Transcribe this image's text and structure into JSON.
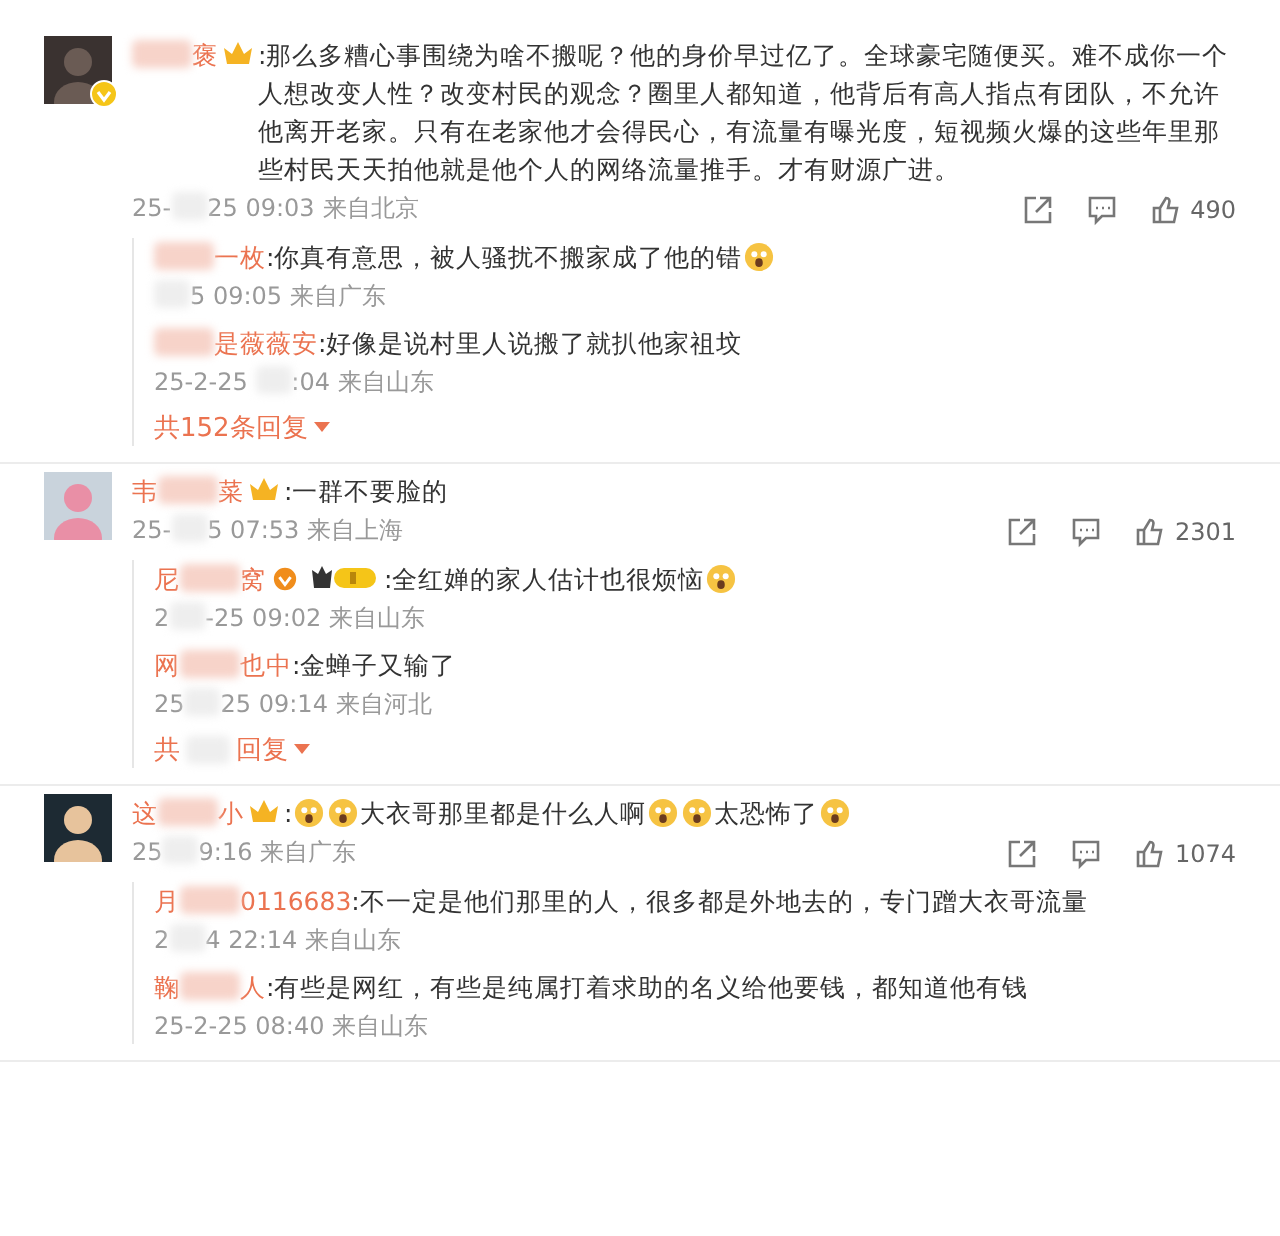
{
  "comments": [
    {
      "avatar": {
        "kind": "photo"
      },
      "verified": true,
      "name": [
        {
          "kind": "blur"
        },
        {
          "kind": "text",
          "text": "褒"
        }
      ],
      "crown": true,
      "content": [
        {
          "kind": "text",
          "text": ":那么多糟心事围绕为啥不搬呢？他的身价早过亿了。全球豪宅随便买。难不成你一个人想改变人性？改变村民的观念？圈里人都知道，他背后有高人指点有团队，不允许他离开老家。只有在老家他才会得民心，有流量有曝光度，短视频火爆的这些年里那些村民天天拍他就是他个人的网络流量推手。才有财源广进。"
        }
      ],
      "time": [
        {
          "kind": "text",
          "text": "25-"
        },
        {
          "kind": "blur"
        },
        {
          "kind": "text",
          "text": "25 09:03"
        }
      ],
      "location": "来自北京",
      "likes": "490",
      "replies": [
        {
          "name": [
            {
              "kind": "blur"
            },
            {
              "kind": "text",
              "text": "一枚"
            }
          ],
          "content": [
            {
              "kind": "text",
              "text": ":你真有意思，被人骚扰不搬家成了他的错"
            },
            {
              "kind": "emoji"
            }
          ],
          "time": [
            {
              "kind": "blur"
            },
            {
              "kind": "text",
              "text": "5 09:05"
            }
          ],
          "location": "来自广东"
        },
        {
          "name": [
            {
              "kind": "blur"
            },
            {
              "kind": "text",
              "text": "是薇薇安"
            }
          ],
          "content": [
            {
              "kind": "text",
              "text": ":好像是说村里人说搬了就扒他家祖坟"
            }
          ],
          "time": [
            {
              "kind": "text",
              "text": "25-2-25 "
            },
            {
              "kind": "blur"
            },
            {
              "kind": "text",
              "text": ":04"
            }
          ],
          "location": "来自山东"
        }
      ],
      "more": [
        {
          "kind": "text",
          "text": "共152条回复"
        }
      ]
    },
    {
      "avatar": {
        "kind": "girl"
      },
      "verified": false,
      "name": [
        {
          "kind": "text",
          "text": "韦"
        },
        {
          "kind": "blur"
        },
        {
          "kind": "text",
          "text": "菜"
        }
      ],
      "crown": true,
      "content": [
        {
          "kind": "text",
          "text": ":一群不要脸的"
        }
      ],
      "time": [
        {
          "kind": "text",
          "text": "25-"
        },
        {
          "kind": "blur"
        },
        {
          "kind": "text",
          "text": "5 07:53"
        }
      ],
      "location": "来自上海",
      "likes": "2301",
      "replies": [
        {
          "name": [
            {
              "kind": "text",
              "text": "尼"
            },
            {
              "kind": "blur"
            },
            {
              "kind": "text",
              "text": "窝"
            }
          ],
          "verified": true,
          "level": true,
          "content": [
            {
              "kind": "text",
              "text": ":全红婵的家人估计也很烦恼"
            },
            {
              "kind": "emoji"
            }
          ],
          "time": [
            {
              "kind": "text",
              "text": "2"
            },
            {
              "kind": "blur"
            },
            {
              "kind": "text",
              "text": "-25 09:02"
            }
          ],
          "location": "来自山东"
        },
        {
          "name": [
            {
              "kind": "text",
              "text": "网"
            },
            {
              "kind": "blur"
            },
            {
              "kind": "text",
              "text": "也中"
            }
          ],
          "content": [
            {
              "kind": "text",
              "text": ":金蝉子又输了"
            }
          ],
          "time": [
            {
              "kind": "text",
              "text": "25"
            },
            {
              "kind": "blur"
            },
            {
              "kind": "text",
              "text": "25 09:14"
            }
          ],
          "location": "来自河北"
        }
      ],
      "more": [
        {
          "kind": "text",
          "text": "共"
        },
        {
          "kind": "blur"
        },
        {
          "kind": "text",
          "text": "回复"
        }
      ]
    },
    {
      "avatar": {
        "kind": "cartoon"
      },
      "verified": false,
      "name": [
        {
          "kind": "text",
          "text": "这"
        },
        {
          "kind": "blur"
        },
        {
          "kind": "text",
          "text": "小"
        }
      ],
      "crown": true,
      "content": [
        {
          "kind": "text",
          "text": ":"
        },
        {
          "kind": "emoji"
        },
        {
          "kind": "emoji"
        },
        {
          "kind": "text",
          "text": "大衣哥那里都是什么人啊"
        },
        {
          "kind": "emoji"
        },
        {
          "kind": "emoji"
        },
        {
          "kind": "text",
          "text": "太恐怖了"
        },
        {
          "kind": "emoji"
        }
      ],
      "time": [
        {
          "kind": "text",
          "text": "25"
        },
        {
          "kind": "blur"
        },
        {
          "kind": "text",
          "text": "9:16"
        }
      ],
      "location": "来自广东",
      "likes": "1074",
      "replies": [
        {
          "name": [
            {
              "kind": "text",
              "text": "月"
            },
            {
              "kind": "blur"
            },
            {
              "kind": "text",
              "text": "0116683"
            }
          ],
          "content": [
            {
              "kind": "text",
              "text": ":不一定是他们那里的人，很多都是外地去的，专门蹭大衣哥流量"
            }
          ],
          "time": [
            {
              "kind": "text",
              "text": "2"
            },
            {
              "kind": "blur"
            },
            {
              "kind": "text",
              "text": "4 22:14"
            }
          ],
          "location": "来自山东"
        },
        {
          "name": [
            {
              "kind": "text",
              "text": "鞠"
            },
            {
              "kind": "blur"
            },
            {
              "kind": "text",
              "text": "人"
            }
          ],
          "content": [
            {
              "kind": "text",
              "text": ":有些是网红，有些是纯属打着求助的名义给他要钱，都知道他有钱"
            }
          ],
          "time": [
            {
              "kind": "text",
              "text": "25-2-25 08:40"
            }
          ],
          "location": "来自山东"
        }
      ]
    }
  ]
}
